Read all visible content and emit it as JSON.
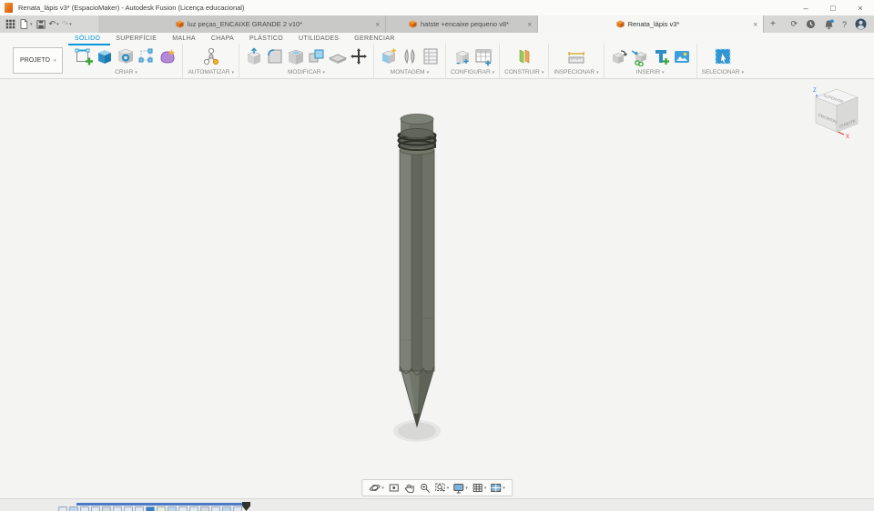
{
  "titlebar": {
    "title": "Renata_lápis v3* (EspacioMaker) - Autodesk Fusion (Licença educacional)"
  },
  "window_controls": {
    "minimize": "–",
    "maximize": "□",
    "close": "×"
  },
  "ui": {
    "caret": "▾",
    "close": "×",
    "new_tab": "+",
    "undo": "↶",
    "redo": "↷",
    "refresh": "⟳",
    "help": "?"
  },
  "document_tabs": [
    {
      "label": "luz peças_ENCAIXE GRANDE 2 v10*"
    },
    {
      "label": "hatste +encaixe pequeno v8*"
    },
    {
      "label": "Renata_lápis v3*"
    }
  ],
  "ribbon": {
    "project_button": "PROJETO",
    "active_tab": "SÓLIDO",
    "tabs": [
      "SÓLIDO",
      "SUPERFÍCIE",
      "MALHA",
      "CHAPA",
      "PLÁSTICO",
      "UTILIDADES",
      "GERENCIAR"
    ],
    "groups": [
      "CRIAR",
      "AUTOMATIZAR",
      "MODIFICAR",
      "MONTAGEM",
      "CONFIGURAR",
      "CONSTRUIR",
      "INSPECIONAR",
      "INSERIR",
      "SELECIONAR"
    ]
  },
  "viewcube": {
    "top": "SUPERIOR",
    "front": "FRONTAL",
    "right": "DIREITA",
    "axis_z": "Z",
    "axis_x": "X"
  },
  "timeline": {
    "icons": [
      "#dfe8f2",
      "#bcd8ee",
      "#dfe8f2",
      "#dfe8f2",
      "#d3d9df",
      "#dfe8f2",
      "#dfe8f2",
      "#dfe8f2",
      "#2f7fd0",
      "#e4eed6",
      "#bcd8ee",
      "#dfe8f2",
      "#dfe8f2",
      "#d3d9df",
      "#dfe8f2",
      "#bcd8ee",
      "#dfe8f2"
    ]
  },
  "colors": {
    "accent": "#0696d7",
    "canvas_bg": "#f4f4f2",
    "pencil_left": "#7d8075",
    "pencil_mid": "#63665b",
    "pencil_right": "#6e7165",
    "shadow": "#dadada",
    "timeline_bar": "#4a7ac8"
  }
}
